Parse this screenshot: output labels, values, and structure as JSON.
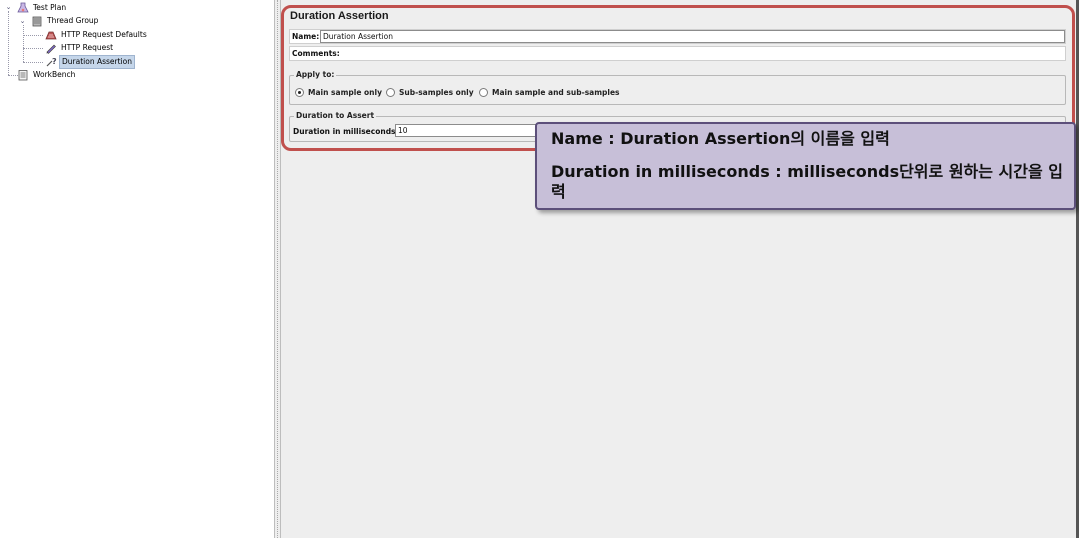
{
  "tree": {
    "items": [
      {
        "label": "Test Plan",
        "icon": "test-plan-icon"
      },
      {
        "label": "Thread Group",
        "icon": "thread-group-icon"
      },
      {
        "label": "HTTP Request Defaults",
        "icon": "config-element-icon"
      },
      {
        "label": "HTTP Request",
        "icon": "sampler-pen-icon"
      },
      {
        "label": "Duration Assertion",
        "icon": "assertion-icon"
      },
      {
        "label": "WorkBench",
        "icon": "workbench-icon"
      }
    ],
    "selected": "Duration Assertion"
  },
  "panel": {
    "title": "Duration Assertion",
    "name_label": "Name:",
    "name_value": "Duration Assertion",
    "comments_label": "Comments:",
    "apply_to": {
      "title": "Apply to:",
      "options": [
        "Main sample only",
        "Sub-samples only",
        "Main sample and sub-samples"
      ],
      "selected": "Main sample only"
    },
    "duration": {
      "title": "Duration to Assert",
      "label": "Duration in milliseconds:",
      "value": "10"
    }
  },
  "callout": {
    "line1": "Name : Duration Assertion의 이름을 입력",
    "line2": "Duration in milliseconds : milliseconds단위로 원하는 시간을 입력"
  },
  "colors": {
    "highlight_border": "#c0504d",
    "callout_bg": "#c7bfd8",
    "callout_border": "#5c4f7a",
    "panel_bg": "#eeeeee"
  }
}
